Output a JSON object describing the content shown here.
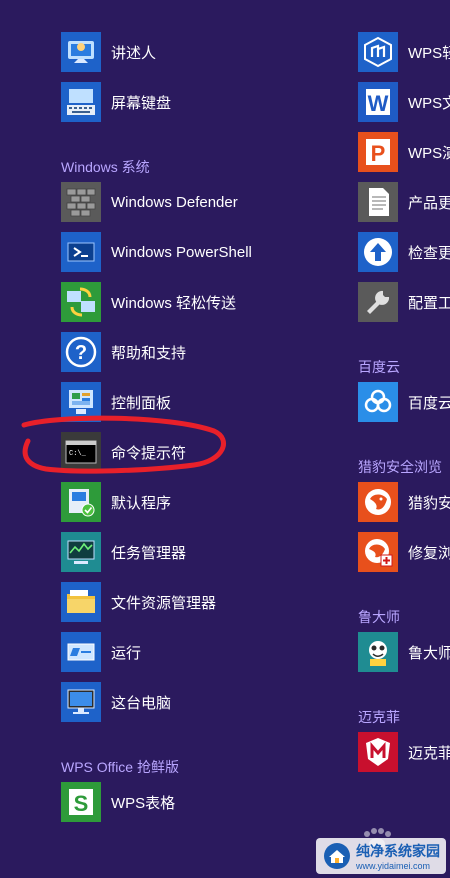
{
  "left_column": {
    "top_items": [
      {
        "label": "讲述人",
        "icon": "narrator-icon"
      },
      {
        "label": "屏幕键盘",
        "icon": "keyboard-icon"
      }
    ],
    "windows_group": {
      "header": "Windows 系统",
      "items": [
        {
          "label": "Windows Defender",
          "icon": "defender-icon"
        },
        {
          "label": "Windows PowerShell",
          "icon": "powershell-icon"
        },
        {
          "label": "Windows 轻松传送",
          "icon": "easy-transfer-icon"
        },
        {
          "label": "帮助和支持",
          "icon": "help-icon"
        },
        {
          "label": "控制面板",
          "icon": "control-panel-icon"
        },
        {
          "label": "命令提示符",
          "icon": "command-prompt-icon"
        },
        {
          "label": "默认程序",
          "icon": "default-programs-icon"
        },
        {
          "label": "任务管理器",
          "icon": "task-manager-icon"
        },
        {
          "label": "文件资源管理器",
          "icon": "file-explorer-icon"
        },
        {
          "label": "运行",
          "icon": "run-icon"
        },
        {
          "label": "这台电脑",
          "icon": "this-pc-icon"
        }
      ]
    },
    "wps_group": {
      "header": "WPS Office 抢鲜版",
      "items": [
        {
          "label": "WPS表格",
          "icon": "wps-spreadsheet-icon"
        }
      ]
    }
  },
  "right_column": {
    "top_items": [
      {
        "label": "WPS轻",
        "icon": "wps-lite-icon"
      },
      {
        "label": "WPS文",
        "icon": "wps-writer-icon"
      },
      {
        "label": "WPS演",
        "icon": "wps-presentation-icon"
      },
      {
        "label": "产品更",
        "icon": "document-icon"
      },
      {
        "label": "检查更",
        "icon": "upload-arrow-icon"
      },
      {
        "label": "配置工",
        "icon": "wrench-icon"
      }
    ],
    "baidu_group": {
      "header": "百度云",
      "items": [
        {
          "label": "百度云",
          "icon": "baidu-cloud-icon"
        }
      ]
    },
    "liebao_group": {
      "header": "猎豹安全浏览",
      "items": [
        {
          "label": "猎豹安",
          "icon": "liebao-browser-icon"
        },
        {
          "label": "修复浏",
          "icon": "liebao-repair-icon"
        }
      ]
    },
    "ludashi_group": {
      "header": "鲁大师",
      "items": [
        {
          "label": "鲁大师",
          "icon": "ludashi-icon"
        }
      ]
    },
    "mcafee_group": {
      "header": "迈克菲",
      "items": [
        {
          "label": "迈克菲",
          "icon": "mcafee-icon"
        }
      ]
    }
  },
  "watermark": {
    "title": "纯净系统家园",
    "url": "www.yidaimei.com"
  },
  "colors": {
    "background": "#2b1a5e",
    "header_text": "#b9a6ff",
    "annotation": "#e8202a",
    "wps_orange": "#e8501c",
    "wps_green": "#2e9b3a",
    "wps_blue": "#1f5bc5"
  }
}
